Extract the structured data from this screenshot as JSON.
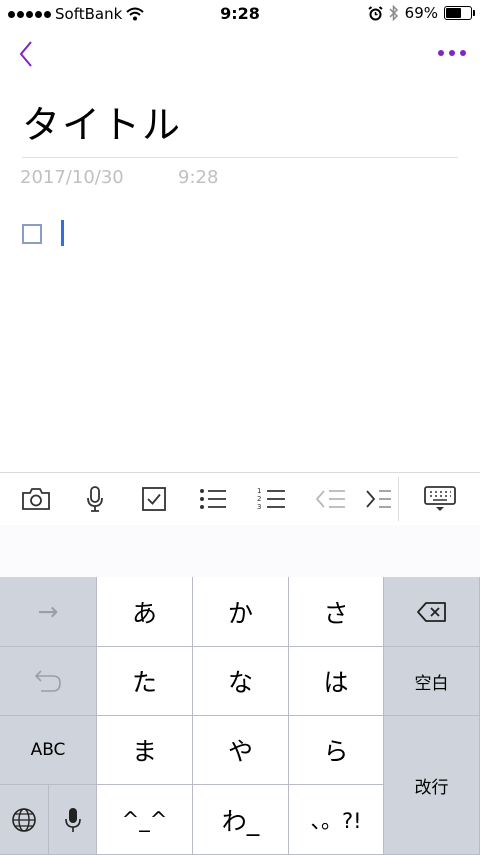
{
  "status_bar": {
    "carrier": "SoftBank",
    "time": "9:28",
    "battery_percent_text": "69%",
    "battery_level": 0.69
  },
  "note": {
    "title": "タイトル",
    "date": "2017/10/30",
    "time": "9:28"
  },
  "colors": {
    "accent": "#8223c8",
    "caret": "#2f6fe0",
    "meta_text": "#c0c0c0"
  },
  "toolbar": {
    "icons": [
      "camera-icon",
      "microphone-icon",
      "checkbox-icon",
      "bulleted-list-icon",
      "numbered-list-icon",
      "outdent-icon",
      "indent-icon",
      "keyboard-dismiss-icon"
    ]
  },
  "keyboard": {
    "next_arrow": "→",
    "a": "あ",
    "ka": "か",
    "sa": "さ",
    "ta": "た",
    "na": "な",
    "ha": "は",
    "space": "空白",
    "abc": "ABC",
    "ma": "ま",
    "ya": "や",
    "ra": "ら",
    "return": "改行",
    "kaomoji": "^_^",
    "wa": "わ_",
    "punct": "、。?!"
  }
}
